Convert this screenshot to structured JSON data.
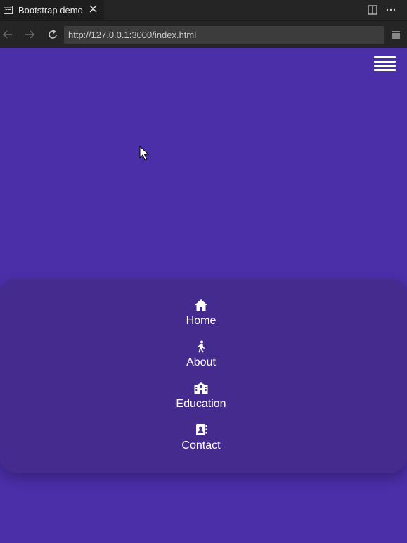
{
  "browser": {
    "tab_title": "Bootstrap demo",
    "tab_icon": "page-icon",
    "url": "http://127.0.0.1:3000/index.html"
  },
  "page": {
    "background_color": "#4a2fa9",
    "panel_color": "#452b8e",
    "menu_toggle_icon": "hamburger-icon",
    "menu": [
      {
        "label": "Home",
        "icon": "home-icon"
      },
      {
        "label": "About",
        "icon": "walking-person-icon"
      },
      {
        "label": "Education",
        "icon": "school-icon"
      },
      {
        "label": "Contact",
        "icon": "address-book-icon"
      }
    ]
  }
}
